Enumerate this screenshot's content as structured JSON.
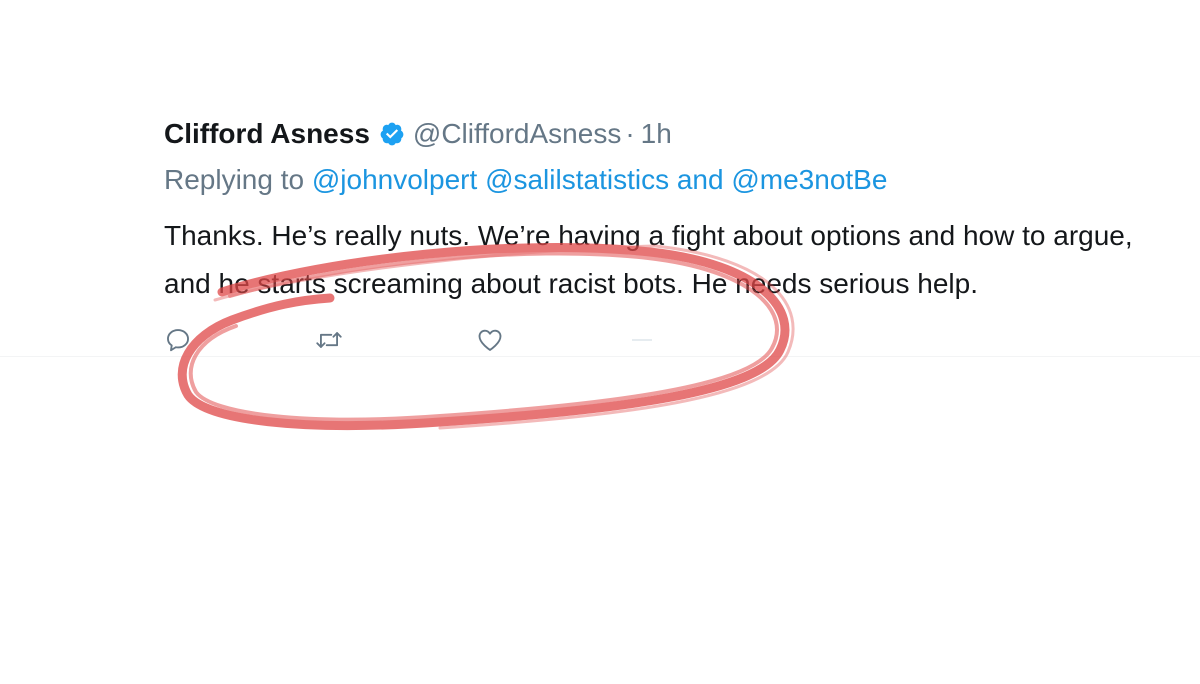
{
  "tweet": {
    "display_name": "Clifford Asness",
    "handle": "@CliffordAsness",
    "separator": "·",
    "time": "1h",
    "reply_prefix": "Replying to",
    "mention_1": "@johnvolpert",
    "mention_2": "@salilstatistics",
    "reply_and": "and",
    "mention_3": "@me3notBe",
    "body": "Thanks. He’s really nuts. We’re having a fight about options and how to argue, and he starts screaming about racist bots. He needs serious help."
  },
  "colors": {
    "name": "#14171a",
    "secondary": "#657786",
    "link": "#1b95e0",
    "verified": "#1da1f2",
    "annotation": "#e04848"
  },
  "icons": {
    "verified": "verified-badge-icon",
    "reply": "reply-icon",
    "retweet": "retweet-icon",
    "like": "like-icon",
    "share": "share-icon"
  }
}
